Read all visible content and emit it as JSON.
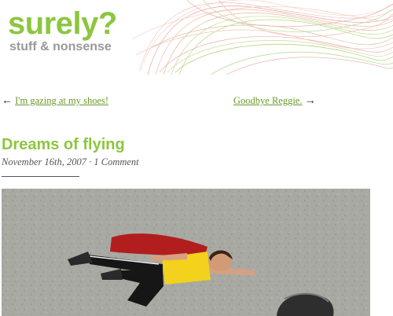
{
  "header": {
    "site_title": "surely?",
    "tagline": "stuff & nonsense"
  },
  "nav": {
    "prev_arrow": "←",
    "prev_label": "I'm gazing at my shoes!",
    "next_label": "Goodbye Reggie.",
    "next_arrow": "→"
  },
  "post": {
    "title": "Dreams of flying",
    "date": "November 16th, 2007",
    "separator": "·",
    "comments": "1 Comment"
  },
  "colors": {
    "accent": "#8cc63f",
    "link": "#6a9a2a",
    "tagline": "#999999"
  }
}
